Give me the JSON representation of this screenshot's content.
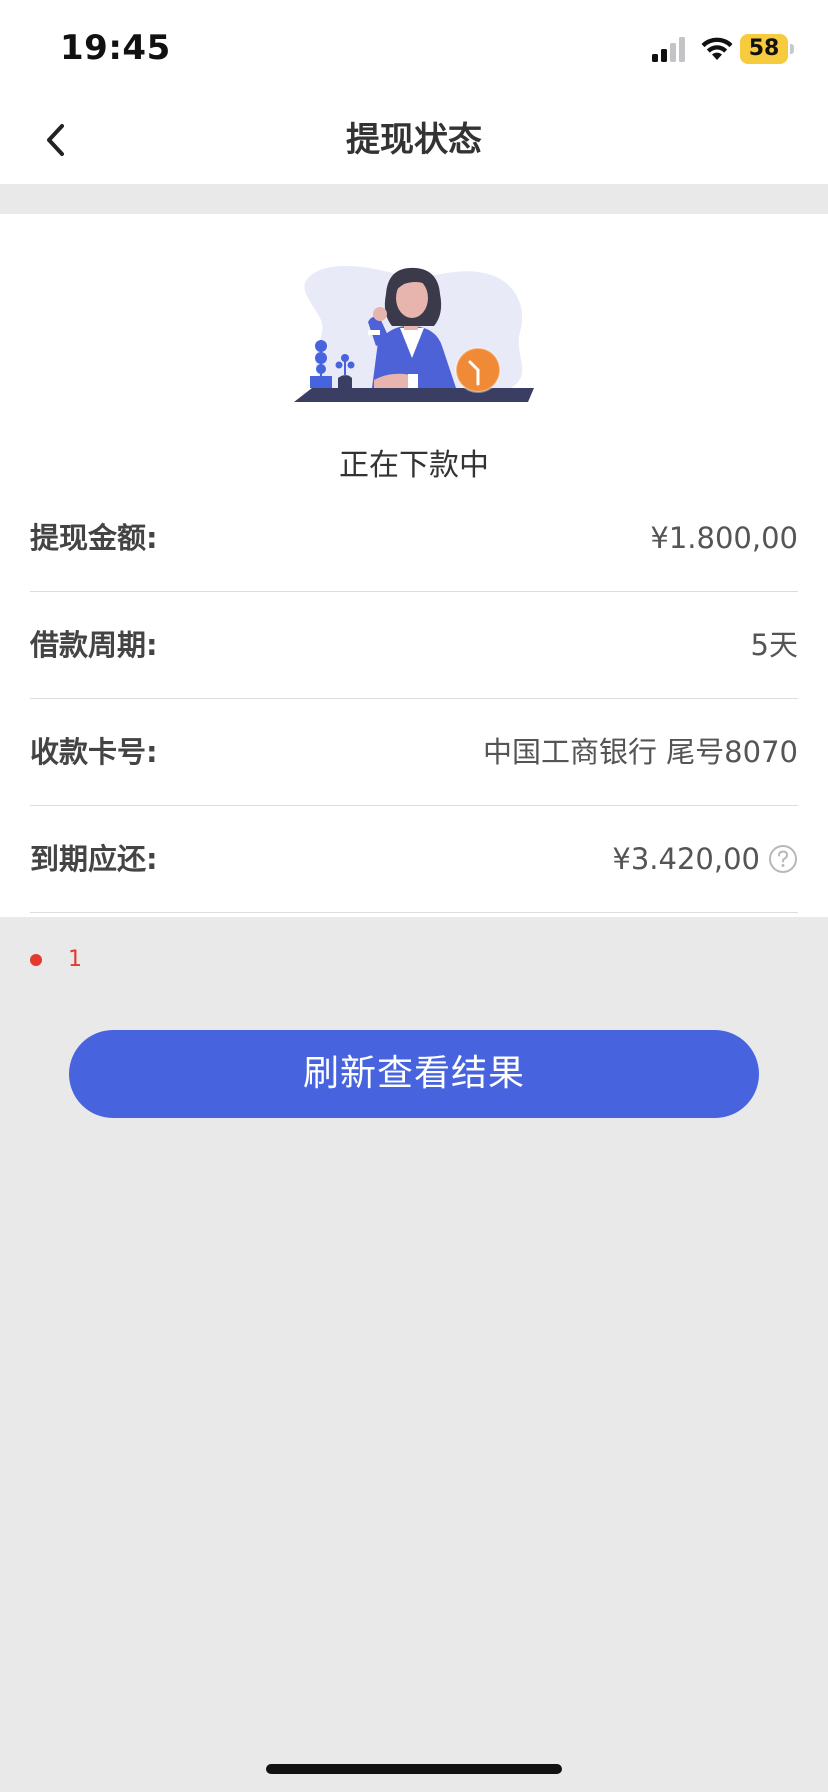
{
  "status_bar": {
    "time": "19:45",
    "battery_level": "58",
    "battery_color": "#f6cb3d",
    "icons": [
      "signal-icon",
      "wifi-icon",
      "battery-icon"
    ]
  },
  "nav": {
    "title": "提现状态",
    "back_icon": "chevron-left-icon"
  },
  "status": {
    "illustration": "woman-waiting-clock-illustration",
    "text": "正在下款中"
  },
  "details": [
    {
      "label": "提现金额:",
      "value": "¥1.800,00"
    },
    {
      "label": "借款周期:",
      "value": "5天"
    },
    {
      "label": "收款卡号:",
      "value": "中国工商银行 尾号8070"
    },
    {
      "label": "到期应还:",
      "value": "¥3.420,00",
      "help_icon": "question-circle-icon"
    }
  ],
  "error_marker": {
    "text": "1",
    "color": "#e23a2e"
  },
  "refresh_button": {
    "label": "刷新查看结果",
    "color": "#4764de"
  }
}
